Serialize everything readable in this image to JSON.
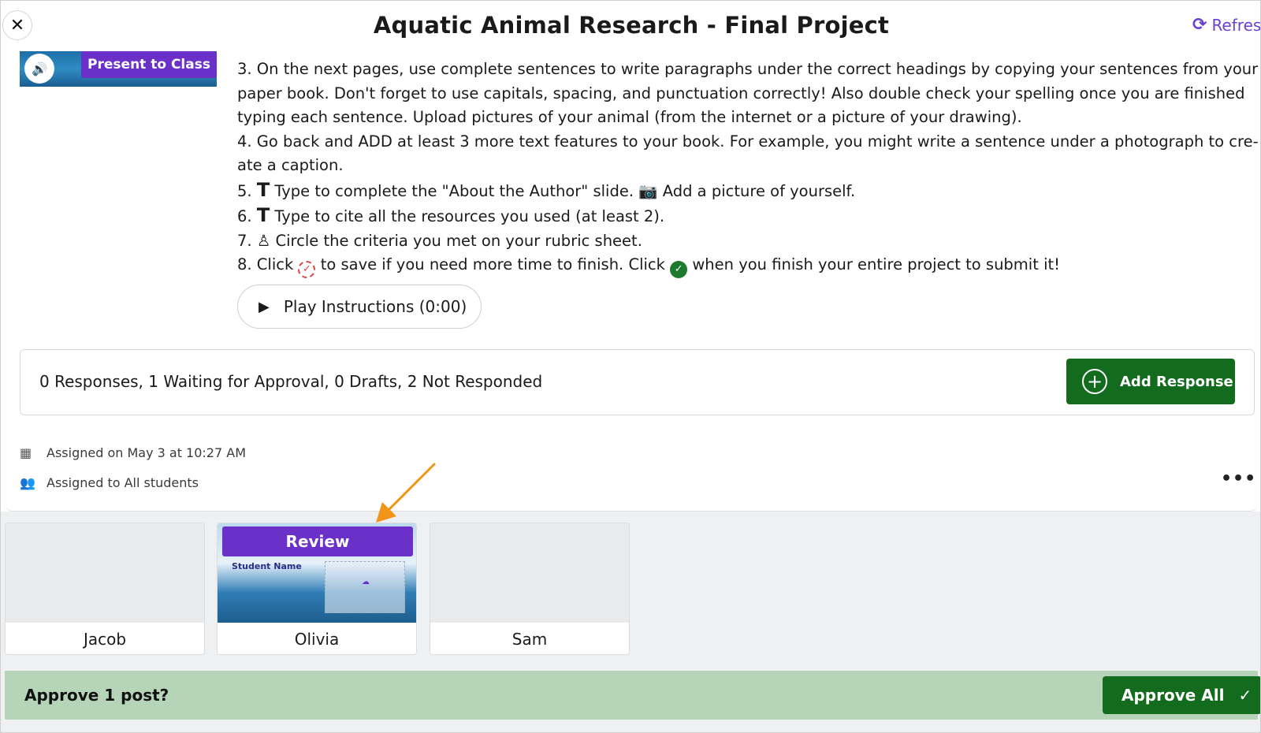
{
  "header": {
    "close_glyph": "✕",
    "title": "Aquatic Animal Research - Final Project",
    "refresh_label": "Refres"
  },
  "media": {
    "present_label": "Present to Class",
    "speaker_glyph": "🔊"
  },
  "instructions": {
    "line1": "3. On the next pages, use complete sentences to write paragraphs under the correct headings by copying your sentences from your",
    "line2": "paper book. Don't forget to use capitals, spacing, and punctuation correctly! Also double check your spelling once you are finished",
    "line3": "typing each sentence. Upload pictures of your animal (from the internet or a picture of your drawing).",
    "line4": "4. Go back and ADD at least 3 more text features to your book. For example, you might write a sentence under a photograph to cre-",
    "line5": "ate a caption.",
    "line6_num": "5.",
    "line6_a": "Type to complete the \"About the Author\" slide.",
    "line6_b": "Add a picture of yourself.",
    "line7_num": "6.",
    "line7": "Type to cite all the resources you used (at least 2).",
    "line8_num": "7.",
    "line8": "Circle the criteria you met on your rubric sheet.",
    "line9_a": "8. Click",
    "line9_b": "to save if you need more time to finish. Click",
    "line9_c": "when you finish your entire project to submit it!",
    "t_glyph": "T",
    "camera_glyph": "📷",
    "marker_glyph": "♙",
    "save_glyph": "✓",
    "submit_glyph": "✓"
  },
  "player": {
    "play_label": "Play Instructions (0:00)",
    "play_glyph": "▶"
  },
  "responses": {
    "summary": "0 Responses, 1 Waiting for Approval, 0 Drafts, 2 Not Responded",
    "add_label": "Add Response",
    "add_glyph": "+"
  },
  "meta": {
    "assigned_on": "Assigned on May 3 at 10:27 AM",
    "assigned_to": "Assigned to All students",
    "calendar_glyph": "▦",
    "people_glyph": "👥",
    "more_glyph": "•••"
  },
  "students": [
    {
      "name": "Jacob"
    },
    {
      "name": "Olivia",
      "action": "Review",
      "thumb_label": "Student Name",
      "thumb_glyph": "☁"
    },
    {
      "name": "Sam"
    }
  ],
  "approve": {
    "prompt": "Approve 1 post?",
    "button_label": "Approve All",
    "button_glyph": "✓"
  },
  "colors": {
    "brand_purple": "#6b30c8",
    "action_green": "#136b1d",
    "approve_bar": "#b5d4b8",
    "arrow_orange": "#f29418"
  }
}
